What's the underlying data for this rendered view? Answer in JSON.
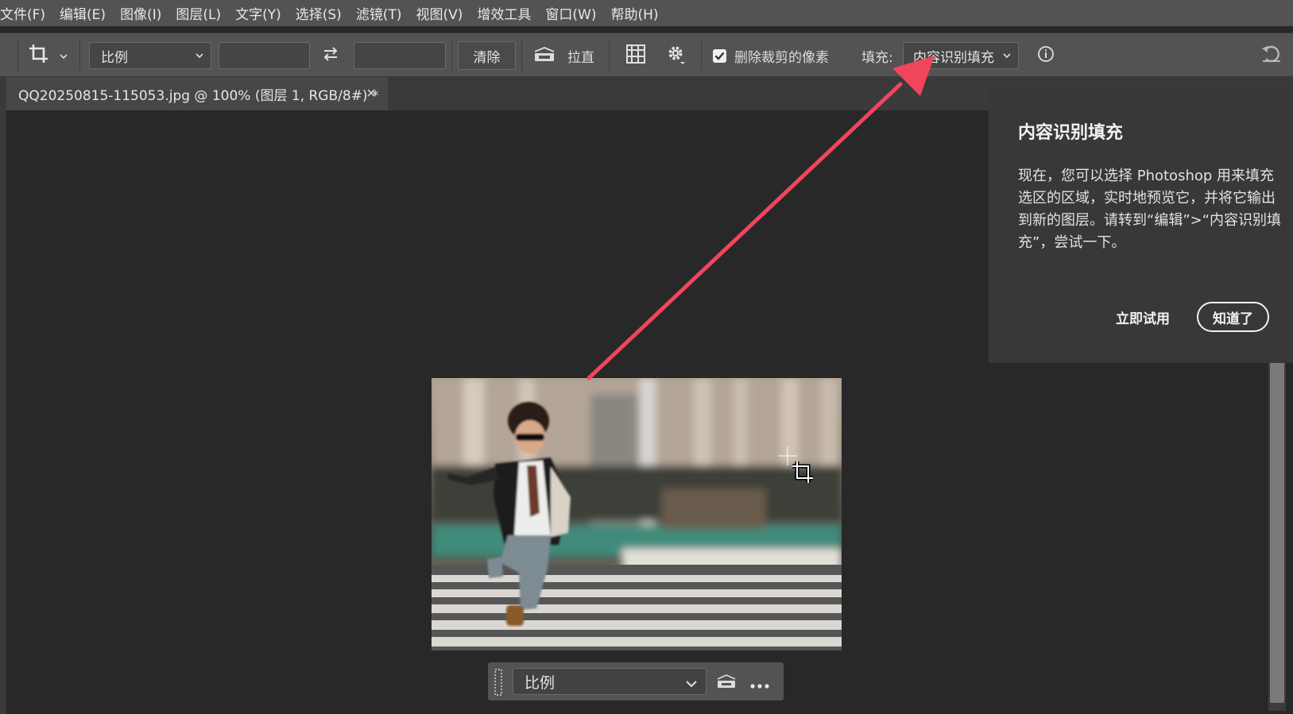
{
  "menu": [
    "文件(F)",
    "编辑(E)",
    "图像(I)",
    "图层(L)",
    "文字(Y)",
    "选择(S)",
    "滤镜(T)",
    "视图(V)",
    "增效工具",
    "窗口(W)",
    "帮助(H)"
  ],
  "options": {
    "tool_icon": "crop-icon",
    "ratio_select": "比例",
    "width_value": "",
    "height_value": "",
    "swap_icon": "swap-arrows-icon",
    "clear_label": "清除",
    "straighten_icon": "level-icon",
    "straighten_label": "拉直",
    "grid_icon": "grid-overlay-icon",
    "settings_icon": "gear-icon",
    "delete_pixels_label": "删除裁剪的像素",
    "delete_pixels_checked": true,
    "fill_label": "填充:",
    "fill_select": "内容识别填充",
    "info_icon": "info-icon",
    "reset_icon": "undo-icon"
  },
  "document": {
    "tab_title": "QQ20250815-115053.jpg @ 100% (图层 1, RGB/8#) *",
    "close_icon": "close-icon"
  },
  "taskbar": {
    "ratio_select": "比例",
    "straighten_icon": "level-icon",
    "more_icon": "more-icon"
  },
  "popup": {
    "title": "内容识别填充",
    "body": "现在，您可以选择 Photoshop 用来填充选区的区域，实时地预览它，并将它输出到新的图层。请转到“编辑”>“内容识别填充”，尝试一下。",
    "try_label": "立即试用",
    "ok_label": "知道了"
  },
  "colors": {
    "arrow": "#f0455c",
    "menubar": "#535353",
    "canvas": "#282828",
    "popup": "#383838"
  }
}
